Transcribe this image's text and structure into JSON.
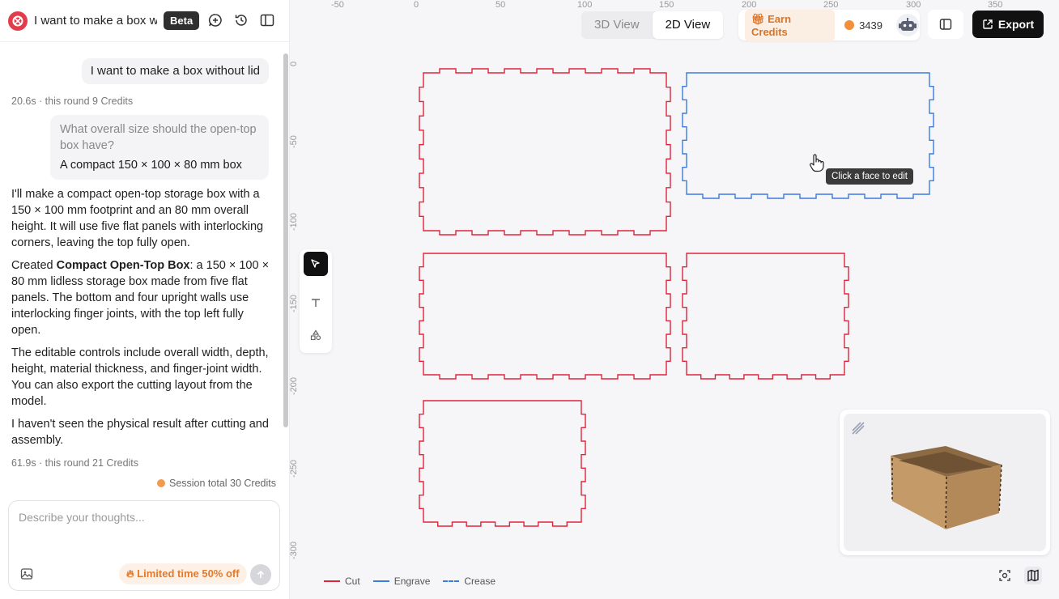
{
  "app": {
    "chat_title": "I want to make a box w...",
    "beta_label": "Beta"
  },
  "chat": {
    "user_message": "I want to make a box without lid",
    "meta1": "20.6s · this round 9 Credits",
    "question": "What overall size should the open-top box have?",
    "answer": "A compact 150 × 100 × 80 mm box",
    "para1": "I'll make a compact open-top storage box with a 150 × 100 mm footprint and an 80 mm overall height. It will use five flat panels with interlocking corners, leaving the top fully open.",
    "para2_prefix": "Created ",
    "para2_bold": "Compact Open-Top Box",
    "para2_rest": ": a 150 × 100 × 80 mm lidless storage box made from five flat panels. The bottom and four upright walls use interlocking finger joints, with the top left fully open.",
    "para3": "The editable controls include overall width, depth, height, material thickness, and finger-joint width. You can also export the cutting layout from the model.",
    "para4": "I haven't seen the physical result after cutting and assembly.",
    "meta2": "61.9s · this round 21 Credits",
    "session_total": "Session total 30 Credits"
  },
  "input": {
    "placeholder": "Describe your thoughts...",
    "promo": "Limited time 50% off"
  },
  "header": {
    "view_3d": "3D View",
    "view_2d": "2D View",
    "earn_credits": "Earn Credits",
    "credits": "3439",
    "export": "Export"
  },
  "canvas": {
    "tooltip": "Click a face to edit",
    "ruler_x": [
      "-50",
      "0",
      "50",
      "100",
      "150",
      "200",
      "250",
      "300",
      "350"
    ],
    "ruler_y": [
      "0",
      "-50",
      "-100",
      "-150",
      "-200",
      "-250",
      "-300"
    ]
  },
  "legend": {
    "cut": "Cut",
    "engrave": "Engrave",
    "crease": "Crease",
    "colors": {
      "cut": "#e0243a",
      "engrave": "#3b7be0",
      "crease": "#3b7be0"
    }
  }
}
